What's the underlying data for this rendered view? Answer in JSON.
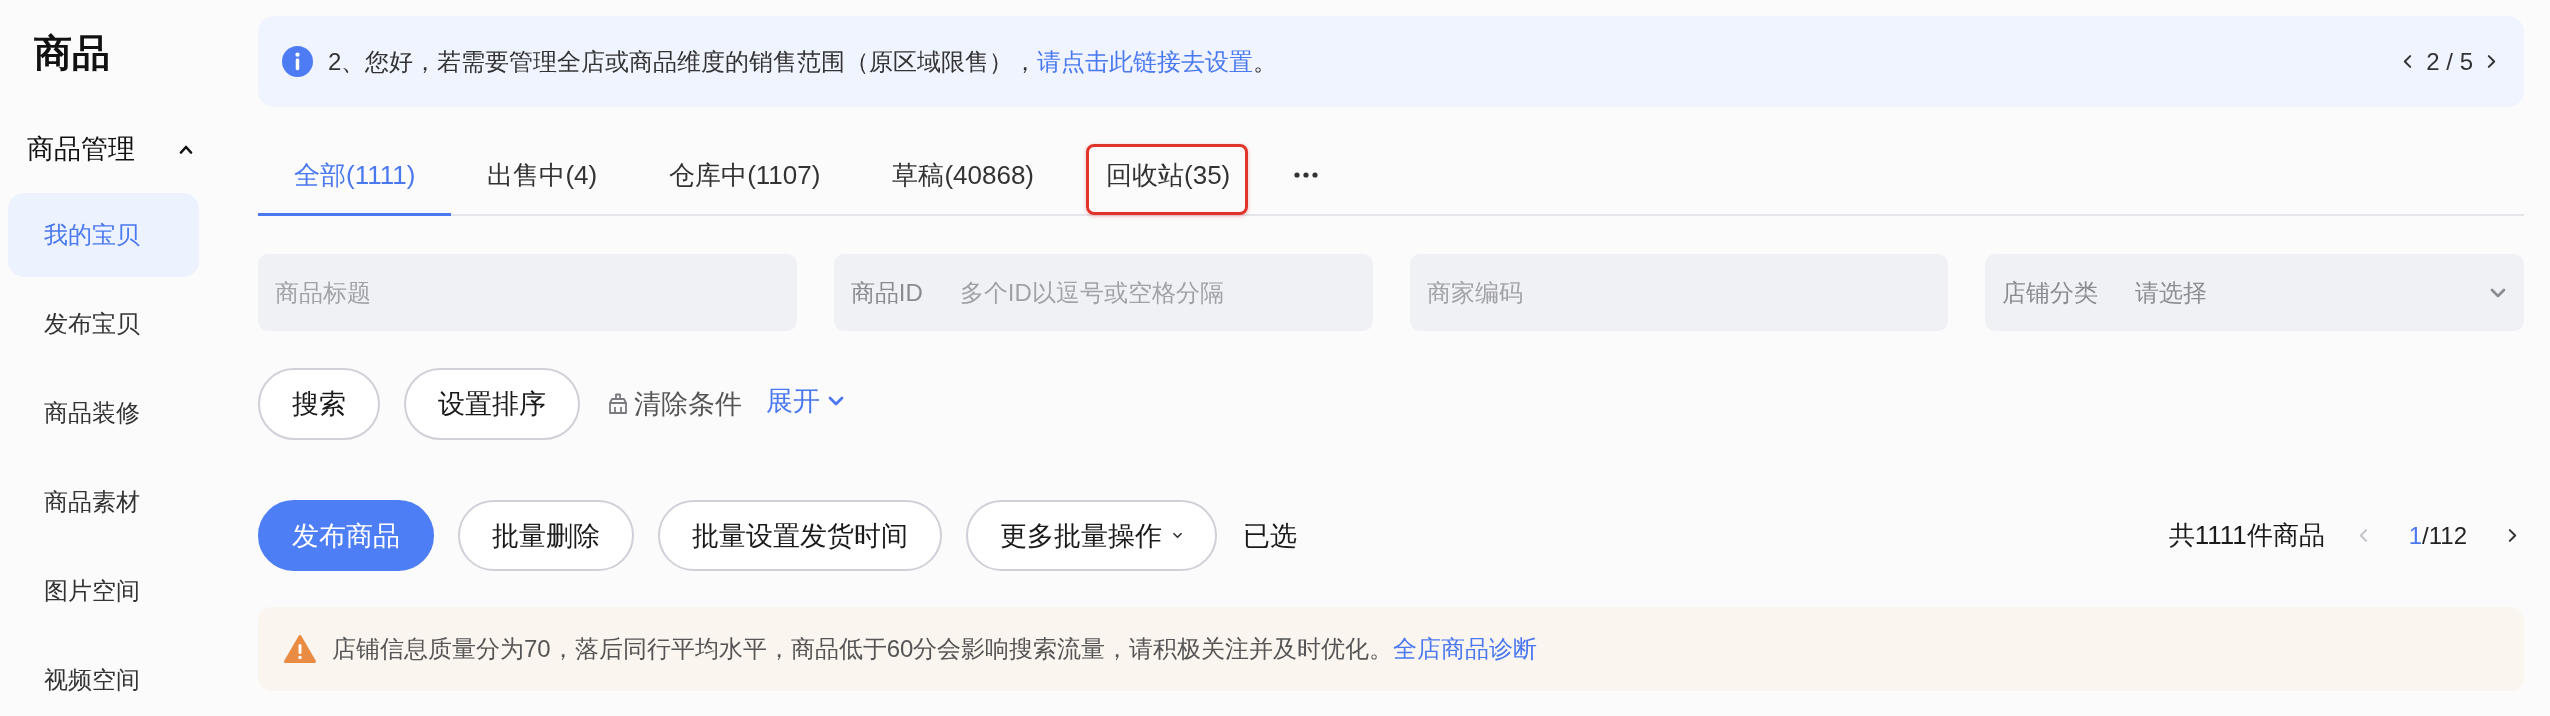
{
  "sidebar": {
    "title": "商品",
    "section": {
      "label": "商品管理",
      "expanded": true,
      "items": [
        {
          "label": "我的宝贝",
          "selected": true
        },
        {
          "label": "发布宝贝",
          "selected": false
        },
        {
          "label": "商品装修",
          "selected": false
        },
        {
          "label": "商品素材",
          "selected": false
        },
        {
          "label": "图片空间",
          "selected": false
        },
        {
          "label": "视频空间",
          "selected": false
        }
      ]
    }
  },
  "notice": {
    "text": "2、您好，若需要管理全店或商品维度的销售范围（原区域限售），",
    "link": "请点击此链接去设置",
    "text_end": "。",
    "pager": "2 / 5"
  },
  "tabs": [
    {
      "label": "全部(1111)",
      "selected": true,
      "highlighted": false
    },
    {
      "label": "出售中(4)",
      "selected": false,
      "highlighted": false
    },
    {
      "label": "仓库中(1107)",
      "selected": false,
      "highlighted": false
    },
    {
      "label": "草稿(40868)",
      "selected": false,
      "highlighted": false
    },
    {
      "label": "回收站(35)",
      "selected": false,
      "highlighted": true
    }
  ],
  "filters": {
    "fields": [
      {
        "kind": "text",
        "placeholder": "商品标题"
      },
      {
        "kind": "labeled",
        "label": "商品ID",
        "placeholder": "多个ID以逗号或空格分隔"
      },
      {
        "kind": "text",
        "placeholder": "商家编码"
      },
      {
        "kind": "select",
        "label": "店铺分类",
        "placeholder": "请选择"
      }
    ],
    "buttons": [
      "搜索",
      "设置排序"
    ],
    "clear": "清除条件",
    "toggle": {
      "label": "展开",
      "expanded": false
    }
  },
  "toolbar": {
    "buttons": [
      {
        "kind": "primary",
        "label": "发布商品"
      },
      {
        "kind": "default",
        "label": "批量删除"
      },
      {
        "kind": "default",
        "label": "批量设置发货时间"
      },
      {
        "kind": "dropdown",
        "label": "更多批量操作"
      }
    ],
    "selected_label": "已选",
    "total": "共1111件商品",
    "pagination": {
      "current": "1",
      "total": "/112",
      "prev_disabled": true,
      "next_disabled": false
    }
  },
  "warning": {
    "text": "店铺信息质量分为70，落后同行平均水平，商品低于60分会影响搜索流量，请积极关注并及时优化。",
    "link": "全店商品诊断"
  }
}
